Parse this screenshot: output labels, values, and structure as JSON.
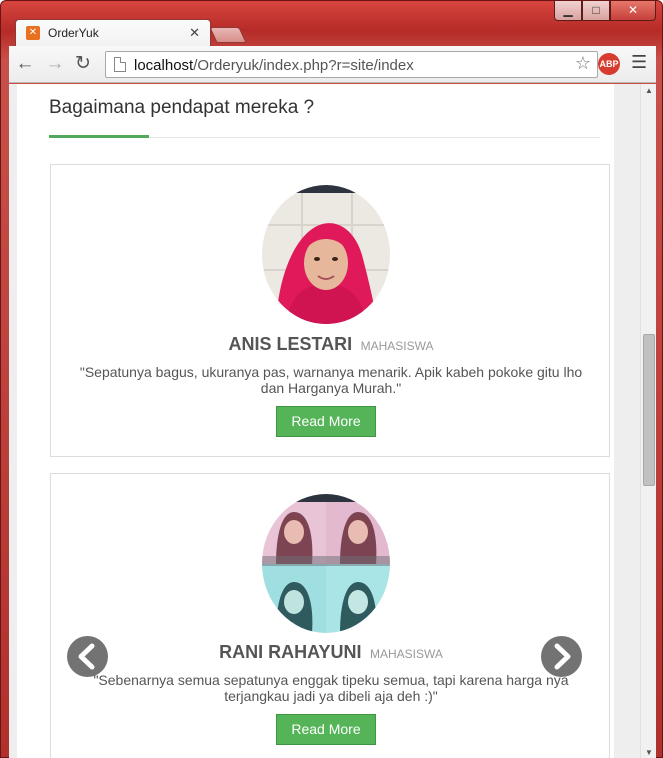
{
  "browser": {
    "tab_title": "OrderYuk",
    "tab_favicon": "xampp-icon",
    "url_host": "localhost",
    "url_path": "/Orderyuk/index.php?r=site/index",
    "abp_label": "ABP",
    "window_buttons": {
      "minimize": "▁",
      "maximize": "□",
      "close": "✕"
    }
  },
  "section": {
    "title": "Bagaimana pendapat mereka ?"
  },
  "testimonials": [
    {
      "name": "ANIS LESTARI",
      "role": "MAHASISWA",
      "quote": "\"Sepatunya bagus, ukuranya pas, warnanya menarik. Apik kabeh pokoke gitu lho dan Harganya Murah.\"",
      "button": "Read More"
    },
    {
      "name": "RANI RAHAYUNI",
      "role": "MAHASISWA",
      "quote": "\"Sebenarnya semua sepatunya enggak tipeku semua, tapi karena harga nya terjangkau jadi ya dibeli aja deh :)\"",
      "button": "Read More"
    }
  ],
  "colors": {
    "accent": "#52a85b",
    "button": "#56b458",
    "chrome_frame": "#c43a35"
  }
}
